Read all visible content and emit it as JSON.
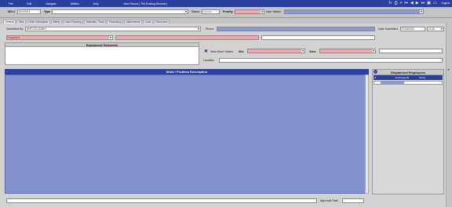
{
  "menu": {
    "items": [
      "File",
      "Edit",
      "Navigate",
      "Utilities",
      "Help"
    ],
    "record_status": "New Record  ( 754 Existing Records )"
  },
  "toolbar": {
    "logout_label": "Logout"
  },
  "header": {
    "wo_label": "WO #",
    "wo_value": "WO19311",
    "type_label": "Type",
    "type_value": "",
    "status_label": "Status",
    "status_value": "Initiated",
    "priority_label": "Priority",
    "priority_value": "",
    "user_status_label": "User Status",
    "user_status_value": ""
  },
  "tabs": [
    "General",
    "Task",
    "Other Information",
    "Safety",
    "Labor Planning",
    "Materials / Tools",
    "Purchasing",
    "Attachments",
    "Costs",
    "Resources"
  ],
  "form": {
    "submitted_by_label": "Submitted By",
    "submitted_by_value": "BHPCON ADMIN",
    "phone_label": "Phone",
    "phone_value": "",
    "date_submitted_label": "Date Submitted",
    "date_submitted_value": "07/16/2024",
    "time_value": "11:08",
    "equipment_value": "Equipment",
    "view_work_orders_label": "View Work Orders",
    "site_label": "Site",
    "zone_label": "Zone",
    "location_label": "Location"
  },
  "sections": {
    "equipment_hierarchy": "Equipment Hierarchy",
    "work_description": "Work / Problem Description",
    "dispatched_employees": "Dispatched Employees",
    "employee_id_col": "Employee ID",
    "name_col": "Name"
  },
  "footer": {
    "approval_date_label": "Approval Date"
  },
  "colors": {
    "accent": "#2b3f9c",
    "required": "#f2a9ad",
    "readonly": "#8b9ad6",
    "panel": "#d2d2d2"
  }
}
